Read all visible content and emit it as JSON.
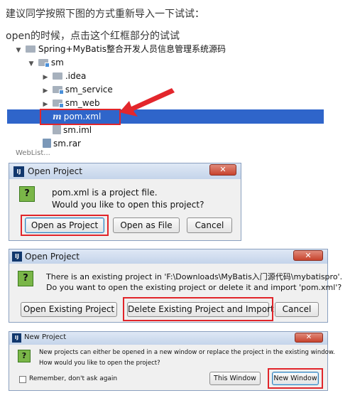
{
  "intro": {
    "line1": "建议同学按照下图的方式重新导入一下试试：",
    "line2": "open的时候，点击这个红框部分的试试"
  },
  "tree": {
    "root": "Spring+MyBatis整合开发人员信息管理系统源码",
    "module": "sm",
    "children": [
      ".idea",
      "sm_service",
      "sm_web"
    ],
    "selected_file": "pom.xml",
    "iml_file": "sm.iml",
    "rar_file": "sm.rar",
    "cut_off_row": "WebList..."
  },
  "dialog1": {
    "title": "Open Project",
    "message_line1": "pom.xml is a project file.",
    "message_line2": "Would you like to open this project?",
    "buttons": {
      "open_project": "Open as Project",
      "open_file": "Open as File",
      "cancel": "Cancel"
    }
  },
  "dialog2": {
    "title": "Open Project",
    "message_line1": "There is an existing project in 'F:\\Downloads\\MyBatis入门源代码\\mybatispro'.",
    "message_line2": "Do you want to open the existing project or delete it and import 'pom.xml'?",
    "buttons": {
      "open_existing": "Open Existing Project",
      "delete_import": "Delete Existing Project and Import",
      "cancel": "Cancel"
    }
  },
  "dialog3": {
    "title": "New Project",
    "message_line1": "New projects can either be opened in a new window or replace the project in the existing window.",
    "message_line2": "How would you like to open the project?",
    "remember_label": "Remember, don't ask again",
    "buttons": {
      "this_window": "This Window",
      "new_window": "New Window"
    }
  },
  "colors": {
    "selection": "#2f65ca",
    "highlight_box": "#e1252a",
    "dialog_body": "#f0f0f0",
    "question_icon": "#7ab648"
  },
  "icons": {
    "folder": "folder-icon",
    "maven_file": "maven-file-icon",
    "question": "question-icon",
    "close": "close-icon"
  }
}
